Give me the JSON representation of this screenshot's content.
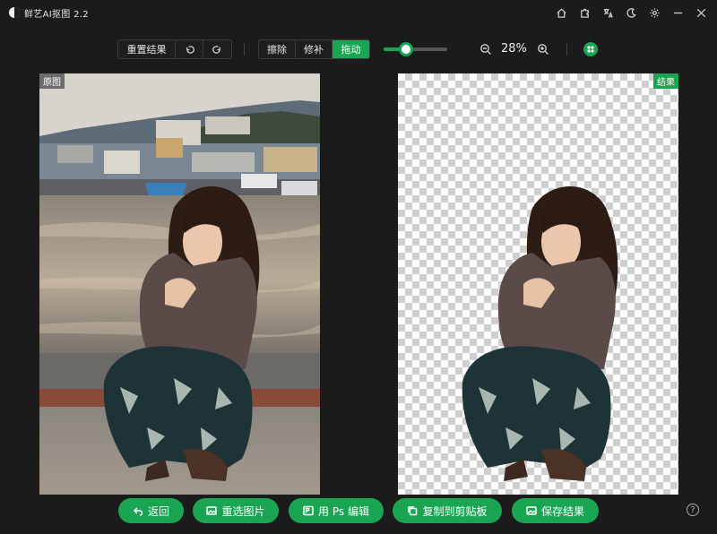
{
  "app": {
    "title": "鲜艺AI抠图  2.2"
  },
  "window_icons": [
    "home-icon",
    "puzzle-icon",
    "translate-icon",
    "moon-icon",
    "gear-icon",
    "minimize-icon",
    "close-icon"
  ],
  "toolbar": {
    "reset_label": "重置结果",
    "mode_buttons": {
      "erase": "擦除",
      "repair": "修补",
      "drag": "拖动"
    },
    "active_mode": "拖动",
    "zoom_slider_level": 0.35,
    "zoom_text": "28%"
  },
  "panels": {
    "original_tag": "原图",
    "result_tag": "结果"
  },
  "actions": {
    "back": "返回",
    "reselect": "重选图片",
    "ps_edit": "用 Ps 编辑",
    "copy": "复制到剪贴板",
    "save": "保存结果"
  },
  "help": "?",
  "colors": {
    "accent": "#1aa552",
    "background": "#1b1b1b"
  }
}
